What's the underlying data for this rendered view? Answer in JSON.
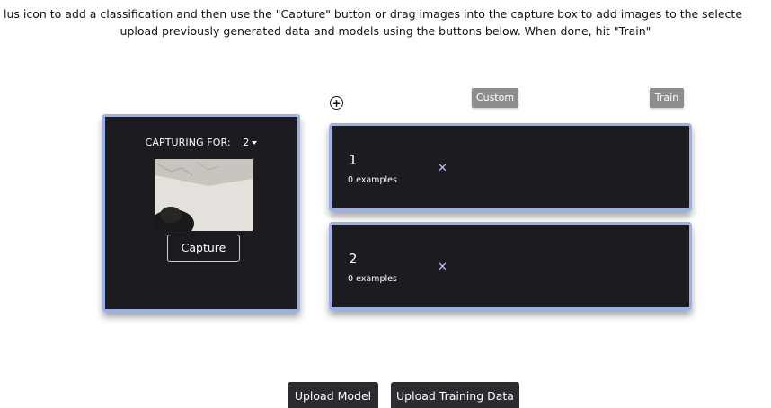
{
  "instructions": {
    "line1": "lus icon to add a classification and then use the \"Capture\" button or drag images into the capture box to add images to the selecte",
    "line2": "upload previously generated data and models using the buttons below. When done, hit \"Train\""
  },
  "toolbar": {
    "add_icon": "plus-circle-icon",
    "custom_label": "Custom",
    "train_label": "Train"
  },
  "capture": {
    "capturing_for_label": "CAPTURING FOR:",
    "selected_class": "2",
    "capture_label": "Capture"
  },
  "classes": [
    {
      "name": "1",
      "examples": "0 examples",
      "remove_icon": "close-icon"
    },
    {
      "name": "2",
      "examples": "0 examples",
      "remove_icon": "close-icon"
    }
  ],
  "bottom": {
    "upload_model_label": "Upload Model",
    "upload_training_label": "Upload Training Data"
  },
  "colors": {
    "panel_bg": "#1c1b1f",
    "panel_border": "#9ab0ea",
    "small_button_bg": "#8d8d8d",
    "bottom_button_bg": "#2a2c30"
  }
}
